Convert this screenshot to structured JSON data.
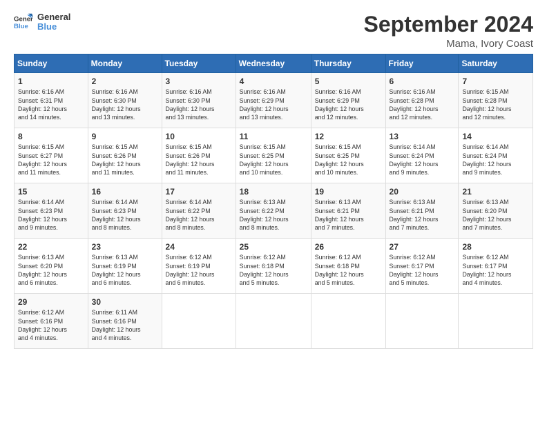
{
  "logo": {
    "line1": "General",
    "line2": "Blue"
  },
  "title": "September 2024",
  "location": "Mama, Ivory Coast",
  "days_of_week": [
    "Sunday",
    "Monday",
    "Tuesday",
    "Wednesday",
    "Thursday",
    "Friday",
    "Saturday"
  ],
  "weeks": [
    [
      {
        "day": "1",
        "info": "Sunrise: 6:16 AM\nSunset: 6:31 PM\nDaylight: 12 hours\nand 14 minutes."
      },
      {
        "day": "2",
        "info": "Sunrise: 6:16 AM\nSunset: 6:30 PM\nDaylight: 12 hours\nand 13 minutes."
      },
      {
        "day": "3",
        "info": "Sunrise: 6:16 AM\nSunset: 6:30 PM\nDaylight: 12 hours\nand 13 minutes."
      },
      {
        "day": "4",
        "info": "Sunrise: 6:16 AM\nSunset: 6:29 PM\nDaylight: 12 hours\nand 13 minutes."
      },
      {
        "day": "5",
        "info": "Sunrise: 6:16 AM\nSunset: 6:29 PM\nDaylight: 12 hours\nand 12 minutes."
      },
      {
        "day": "6",
        "info": "Sunrise: 6:16 AM\nSunset: 6:28 PM\nDaylight: 12 hours\nand 12 minutes."
      },
      {
        "day": "7",
        "info": "Sunrise: 6:15 AM\nSunset: 6:28 PM\nDaylight: 12 hours\nand 12 minutes."
      }
    ],
    [
      {
        "day": "8",
        "info": "Sunrise: 6:15 AM\nSunset: 6:27 PM\nDaylight: 12 hours\nand 11 minutes."
      },
      {
        "day": "9",
        "info": "Sunrise: 6:15 AM\nSunset: 6:26 PM\nDaylight: 12 hours\nand 11 minutes."
      },
      {
        "day": "10",
        "info": "Sunrise: 6:15 AM\nSunset: 6:26 PM\nDaylight: 12 hours\nand 11 minutes."
      },
      {
        "day": "11",
        "info": "Sunrise: 6:15 AM\nSunset: 6:25 PM\nDaylight: 12 hours\nand 10 minutes."
      },
      {
        "day": "12",
        "info": "Sunrise: 6:15 AM\nSunset: 6:25 PM\nDaylight: 12 hours\nand 10 minutes."
      },
      {
        "day": "13",
        "info": "Sunrise: 6:14 AM\nSunset: 6:24 PM\nDaylight: 12 hours\nand 9 minutes."
      },
      {
        "day": "14",
        "info": "Sunrise: 6:14 AM\nSunset: 6:24 PM\nDaylight: 12 hours\nand 9 minutes."
      }
    ],
    [
      {
        "day": "15",
        "info": "Sunrise: 6:14 AM\nSunset: 6:23 PM\nDaylight: 12 hours\nand 9 minutes."
      },
      {
        "day": "16",
        "info": "Sunrise: 6:14 AM\nSunset: 6:23 PM\nDaylight: 12 hours\nand 8 minutes."
      },
      {
        "day": "17",
        "info": "Sunrise: 6:14 AM\nSunset: 6:22 PM\nDaylight: 12 hours\nand 8 minutes."
      },
      {
        "day": "18",
        "info": "Sunrise: 6:13 AM\nSunset: 6:22 PM\nDaylight: 12 hours\nand 8 minutes."
      },
      {
        "day": "19",
        "info": "Sunrise: 6:13 AM\nSunset: 6:21 PM\nDaylight: 12 hours\nand 7 minutes."
      },
      {
        "day": "20",
        "info": "Sunrise: 6:13 AM\nSunset: 6:21 PM\nDaylight: 12 hours\nand 7 minutes."
      },
      {
        "day": "21",
        "info": "Sunrise: 6:13 AM\nSunset: 6:20 PM\nDaylight: 12 hours\nand 7 minutes."
      }
    ],
    [
      {
        "day": "22",
        "info": "Sunrise: 6:13 AM\nSunset: 6:20 PM\nDaylight: 12 hours\nand 6 minutes."
      },
      {
        "day": "23",
        "info": "Sunrise: 6:13 AM\nSunset: 6:19 PM\nDaylight: 12 hours\nand 6 minutes."
      },
      {
        "day": "24",
        "info": "Sunrise: 6:12 AM\nSunset: 6:19 PM\nDaylight: 12 hours\nand 6 minutes."
      },
      {
        "day": "25",
        "info": "Sunrise: 6:12 AM\nSunset: 6:18 PM\nDaylight: 12 hours\nand 5 minutes."
      },
      {
        "day": "26",
        "info": "Sunrise: 6:12 AM\nSunset: 6:18 PM\nDaylight: 12 hours\nand 5 minutes."
      },
      {
        "day": "27",
        "info": "Sunrise: 6:12 AM\nSunset: 6:17 PM\nDaylight: 12 hours\nand 5 minutes."
      },
      {
        "day": "28",
        "info": "Sunrise: 6:12 AM\nSunset: 6:17 PM\nDaylight: 12 hours\nand 4 minutes."
      }
    ],
    [
      {
        "day": "29",
        "info": "Sunrise: 6:12 AM\nSunset: 6:16 PM\nDaylight: 12 hours\nand 4 minutes."
      },
      {
        "day": "30",
        "info": "Sunrise: 6:11 AM\nSunset: 6:16 PM\nDaylight: 12 hours\nand 4 minutes."
      },
      {
        "day": "",
        "info": ""
      },
      {
        "day": "",
        "info": ""
      },
      {
        "day": "",
        "info": ""
      },
      {
        "day": "",
        "info": ""
      },
      {
        "day": "",
        "info": ""
      }
    ]
  ]
}
